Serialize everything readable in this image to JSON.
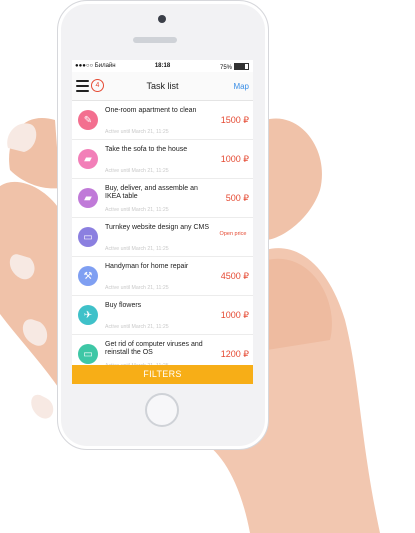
{
  "status_bar": {
    "carrier": "●●●○○ Билайн",
    "wifi": "wifi-icon",
    "time": "18:18",
    "battery_pct": "75%"
  },
  "navbar": {
    "badge_count": "4",
    "title": "Task list",
    "map_label": "Map"
  },
  "tasks": [
    {
      "title": "One-room apartment to clean",
      "subtitle": "Active until March 21, 11:25",
      "price": "1500 ₽",
      "icon": "broom-icon",
      "color": "#f36f8f"
    },
    {
      "title": "Take the sofa to the house",
      "subtitle": "Active until March 21, 11:25",
      "price": "1000 ₽",
      "icon": "truck-icon",
      "color": "#f27fb8"
    },
    {
      "title": "Buy, deliver, and assemble an IKEA table",
      "subtitle": "Active until March 21, 11:25",
      "price": "500 ₽",
      "icon": "truck-icon",
      "color": "#c07ad8"
    },
    {
      "title": "Turnkey website design any CMS",
      "subtitle": "Active until March 21, 11:25",
      "price": "Open price",
      "icon": "monitor-icon",
      "color": "#8b7fe0"
    },
    {
      "title": "Handyman for home repair",
      "subtitle": "Active until March 21, 11:25",
      "price": "4500 ₽",
      "icon": "wrench-icon",
      "color": "#7f9ff2"
    },
    {
      "title": "Buy flowers",
      "subtitle": "Active until March 21, 11:25",
      "price": "1000 ₽",
      "icon": "runner-icon",
      "color": "#3fc1c9"
    },
    {
      "title": "Get rid of computer viruses and reinstall the OS",
      "subtitle": "Active until March 21, 11:25",
      "price": "1200 ₽",
      "icon": "monitor-icon",
      "color": "#3ec7a6"
    }
  ],
  "filters_label": "FILTERS"
}
